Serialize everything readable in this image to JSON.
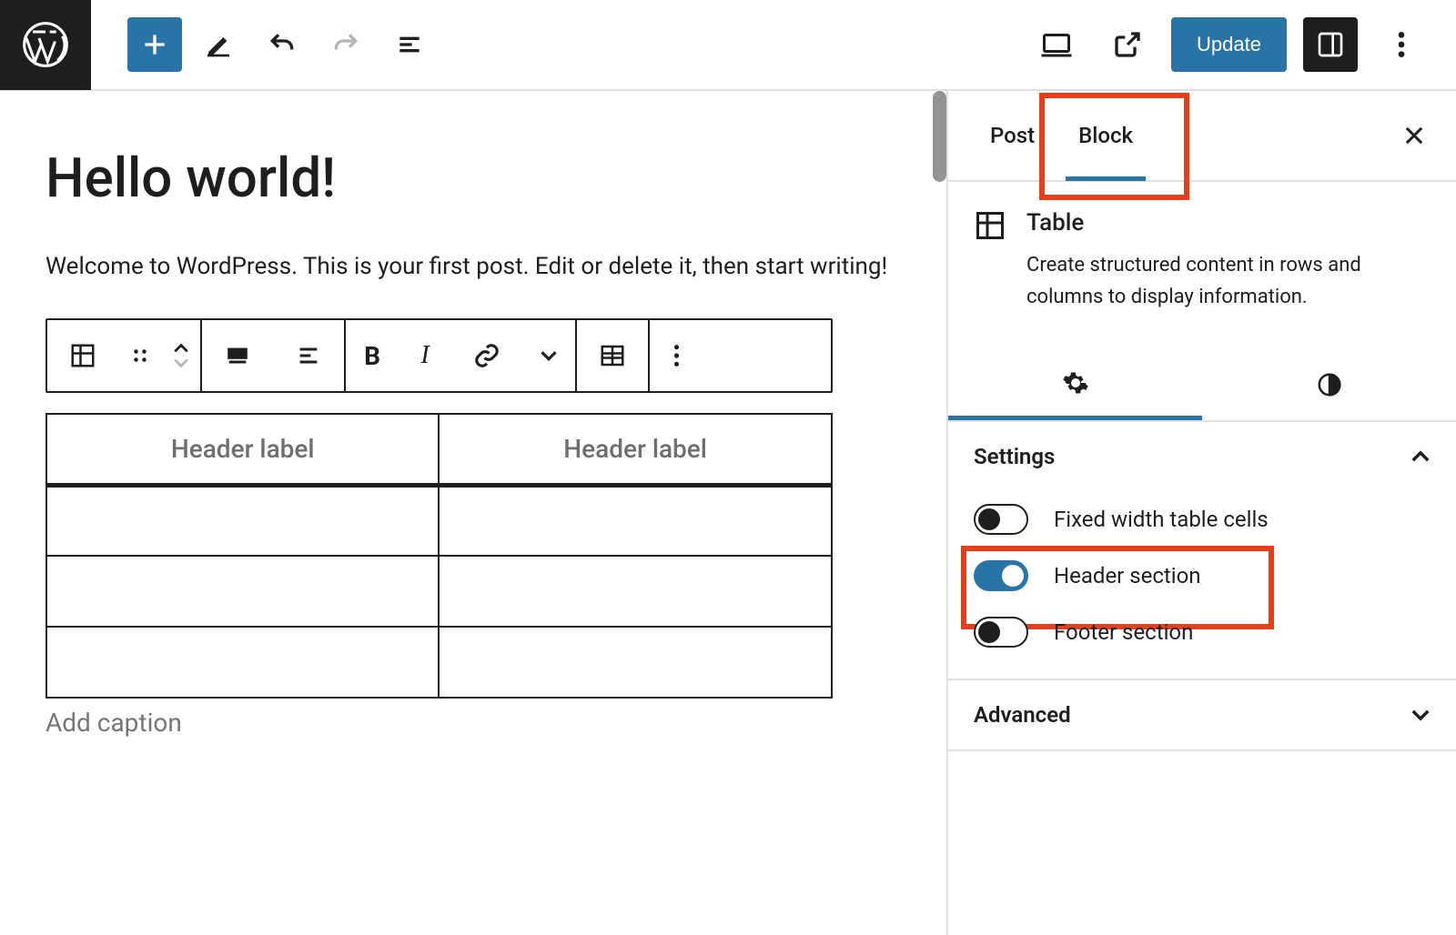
{
  "topbar": {
    "update_label": "Update"
  },
  "editor": {
    "title": "Hello world!",
    "paragraph": "Welcome to WordPress. This is your first post. Edit or delete it, then start writing!",
    "table": {
      "headers": [
        "Header label",
        "Header label"
      ]
    },
    "caption_placeholder": "Add caption"
  },
  "sidebar": {
    "tabs": {
      "post": "Post",
      "block": "Block"
    },
    "block_info": {
      "title": "Table",
      "desc": "Create structured content in rows and columns to display information."
    },
    "settings": {
      "heading": "Settings",
      "fixed_width": "Fixed width table cells",
      "header_section": "Header section",
      "footer_section": "Footer section"
    },
    "advanced": {
      "heading": "Advanced"
    }
  }
}
